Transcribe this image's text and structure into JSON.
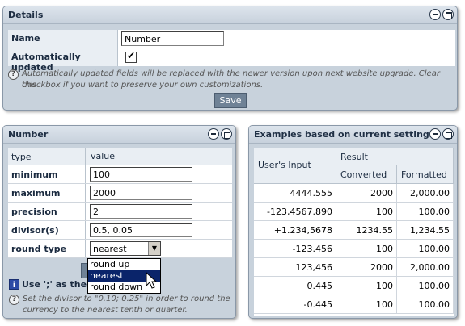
{
  "details": {
    "title": "Details",
    "name_label": "Name",
    "name_value": "Number",
    "auto_label": "Automatically updated",
    "auto_checked": true,
    "help_text_1": "Automatically updated fields will be replaced with the newer version upon next website upgrade. Clear this",
    "help_text_2": "checkbox if you want to preserve your own customizations.",
    "save_label": "Save"
  },
  "number": {
    "title": "Number",
    "col_type": "type",
    "col_value": "value",
    "rows": [
      {
        "label": "minimum",
        "value": "100"
      },
      {
        "label": "maximum",
        "value": "2000"
      },
      {
        "label": "precision",
        "value": "2"
      },
      {
        "label": "divisor(s)",
        "value": "0.5, 0.05"
      }
    ],
    "round_label": "round type",
    "round_selected": "nearest",
    "round_options": [
      "round up",
      "nearest",
      "round down"
    ],
    "info_text": "Use ';' as the d",
    "help_text_1": "Set the divisor to \"0.10; 0.25\" in order to round the",
    "help_text_2": "currency to the nearest tenth or quarter."
  },
  "examples": {
    "title": "Examples based on current settings",
    "col_input": "User's Input",
    "col_result": "Result",
    "col_converted": "Converted",
    "col_formatted": "Formatted",
    "rows": [
      {
        "input": "4444.555",
        "converted": "2000",
        "formatted": "2,000.00"
      },
      {
        "input": "-123,4567.890",
        "converted": "100",
        "formatted": "100.00"
      },
      {
        "input": "+1.234,5678",
        "converted": "1234.55",
        "formatted": "1,234.55"
      },
      {
        "input": "-123.456",
        "converted": "100",
        "formatted": "100.00"
      },
      {
        "input": "123,456",
        "converted": "2000",
        "formatted": "2,000.00"
      },
      {
        "input": "0.445",
        "converted": "100",
        "formatted": "100.00"
      },
      {
        "input": "-0.445",
        "converted": "100",
        "formatted": "100.00"
      }
    ]
  }
}
